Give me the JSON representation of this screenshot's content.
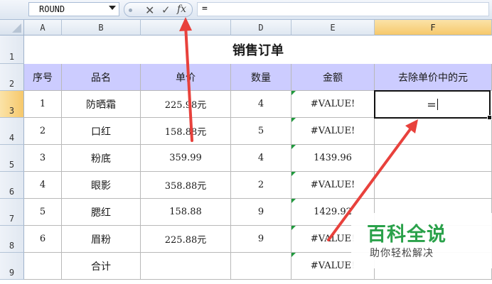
{
  "formula_bar": {
    "name_box": "ROUND",
    "cancel_icon": "x-icon",
    "enter_icon": "check-icon",
    "insert_function_label": "fx",
    "formula": "="
  },
  "columns": [
    "A",
    "B",
    "C",
    "D",
    "E",
    "F"
  ],
  "active_column": "F",
  "rows": [
    "1",
    "2",
    "3",
    "4",
    "5",
    "6",
    "7",
    "8",
    "9"
  ],
  "active_row": "3",
  "title": "销售订单",
  "headers": {
    "seq": "序号",
    "name": "品名",
    "price": "单价",
    "qty": "数量",
    "amount": "金额",
    "f": "去除单价中的元"
  },
  "data_rows": [
    {
      "seq": "1",
      "name": "防晒霜",
      "price": "225.98元",
      "qty": "4",
      "amount": "#VALUE!"
    },
    {
      "seq": "2",
      "name": "口红",
      "price": "158.88元",
      "qty": "5",
      "amount": "#VALUE!"
    },
    {
      "seq": "3",
      "name": "粉底",
      "price": "359.99",
      "qty": "4",
      "amount": "1439.96"
    },
    {
      "seq": "4",
      "name": "眼影",
      "price": "358.88元",
      "qty": "2",
      "amount": "#VALUE!"
    },
    {
      "seq": "5",
      "name": "腮红",
      "price": "158.88",
      "qty": "9",
      "amount": "1429.92"
    },
    {
      "seq": "6",
      "name": "眉粉",
      "price": "225.88元",
      "qty": "9",
      "amount": "#VALUE!"
    }
  ],
  "total": {
    "label": "合计",
    "amount": "#VALUE!"
  },
  "editing_cell": {
    "ref": "F3",
    "value": "="
  },
  "annotation_color": "#e8413c",
  "header_fill": "#ccccff",
  "watermark": {
    "main": "百科全说",
    "sub": "助你轻松解决"
  }
}
